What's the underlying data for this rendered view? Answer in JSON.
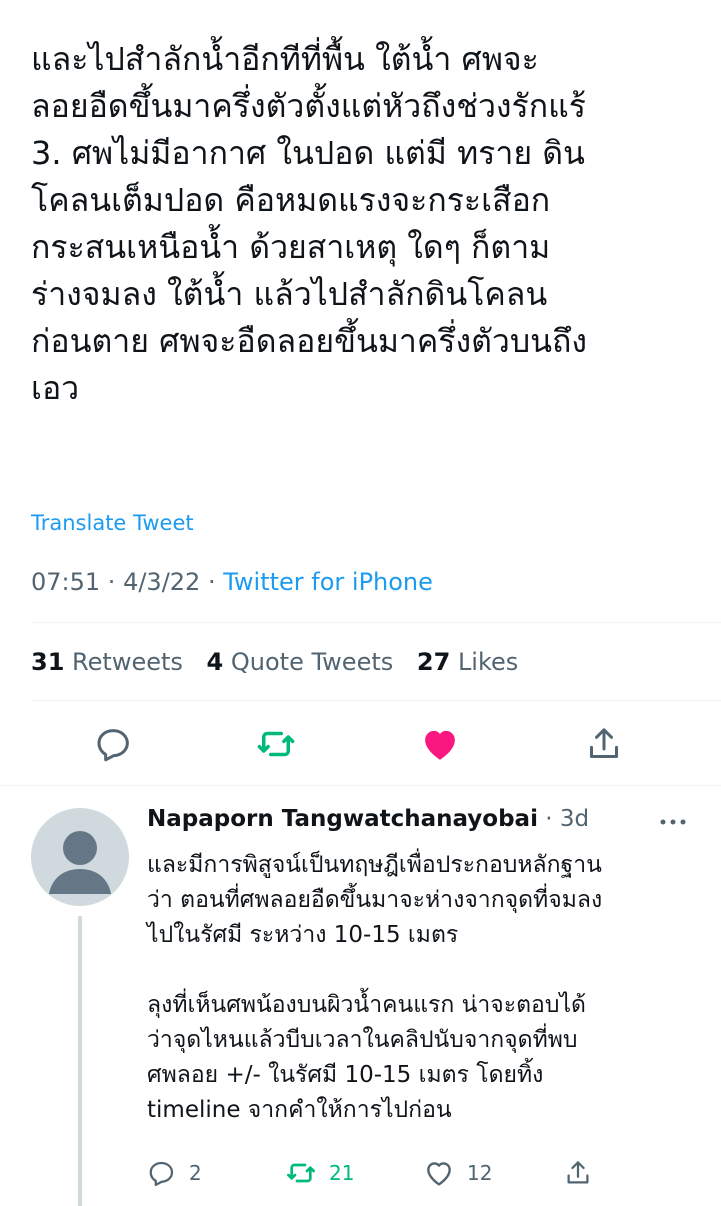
{
  "tweet": {
    "lines": [
      "และไปสำลักน้ำอีกทีที่พื้น ใต้น้ำ ศพจะ",
      "ลอยอืดขึ้นมาครึ่งตัวตั้งแต่หัวถึงช่วงรักแร้",
      "3. ศพไม่มีอากาศ ในปอด แต่มี ทราย ดิน",
      "โคลนเต็มปอด คือหมดแรงจะกระเสือก",
      "กระสนเหนือน้ำ ด้วยสาเหตุ ใดๆ ก็ตาม",
      "ร่างจมลง ใต้น้ำ แล้วไปสำลักดินโคลน",
      "ก่อนตาย ศพจะอืดลอยขึ้นมาครึ่งตัวบนถึง",
      "เอว"
    ],
    "translate_label": "Translate Tweet",
    "time": "07:51",
    "date": "4/3/22",
    "separator": " · ",
    "source": "Twitter for iPhone",
    "stats": {
      "retweets_count": "31",
      "retweets_label": "Retweets",
      "quotes_count": "4",
      "quotes_label": "Quote Tweets",
      "likes_count": "27",
      "likes_label": "Likes"
    },
    "colors": {
      "retweet_active": "#00ba7c",
      "like_active": "#f91880",
      "link": "#1d9bf0",
      "muted": "#536471"
    },
    "icons": [
      "reply-icon",
      "retweet-icon",
      "like-icon",
      "share-icon"
    ]
  },
  "reply": {
    "name": "Napaporn Tangwatchanayobai",
    "time": "· 3d",
    "lines": [
      "และมีการพิสูจน์เป็นทฤษฎีเพื่อประกอบหลักฐาน",
      "ว่า ตอนที่ศพลอยอืดขึ้นมาจะห่างจากจุดที่จมลง",
      "ไปในรัศมี ระหว่าง 10-15 เมตร",
      "",
      "ลุงที่เห็นศพน้องบนผิวน้ำคนแรก น่าจะตอบได้",
      "ว่าจุดไหนแล้วบีบเวลาในคลิปนับจากจุดที่พบ",
      "ศพลอย +/- ในรัศมี 10-15 เมตร โดยทิ้ง",
      "timeline จากคำให้การไปก่อน"
    ],
    "reply_count": "2",
    "retweet_count": "21",
    "like_count": "12"
  }
}
